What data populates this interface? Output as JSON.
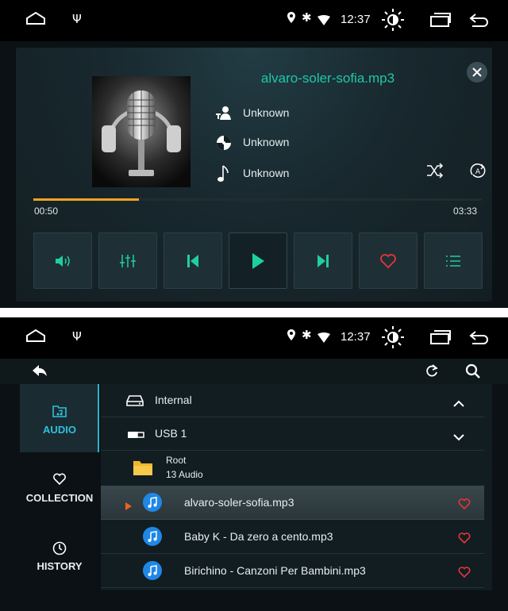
{
  "status_bar": {
    "time": "12:37",
    "icons": [
      "home-icon",
      "usb-icon",
      "location-icon",
      "bluetooth-icon",
      "wifi-icon",
      "brightness-icon",
      "recents-icon",
      "back-icon"
    ]
  },
  "player": {
    "title": "alvaro-soler-sofia.mp3",
    "artist": "Unknown",
    "album": "Unknown",
    "genre": "Unknown",
    "current_time": "00:50",
    "total_time": "03:33",
    "progress": 0.235,
    "accent_color": "#1fc7a8",
    "progress_color": "#f2a51f",
    "controls": [
      "volume",
      "equalizer",
      "previous",
      "play",
      "next",
      "favorite",
      "playlist"
    ]
  },
  "library": {
    "tabs": [
      {
        "label": "AUDIO",
        "icon": "music-folder-icon",
        "active": true
      },
      {
        "label": "COLLECTION",
        "icon": "heart-icon",
        "active": false
      },
      {
        "label": "HISTORY",
        "icon": "clock-icon",
        "active": false
      }
    ],
    "drives": [
      {
        "label": "Internal",
        "expanded": true
      },
      {
        "label": "USB 1",
        "expanded": false
      }
    ],
    "folder": {
      "name": "Root",
      "count": "13 Audio"
    },
    "tracks": [
      {
        "name": "alvaro-soler-sofia.mp3",
        "playing": true
      },
      {
        "name": "Baby K - Da zero a cento.mp3",
        "playing": false
      },
      {
        "name": "Birichino - Canzoni Per Bambini.mp3",
        "playing": false
      }
    ],
    "active_color": "#2ec0dc",
    "favorite_color": "#e5343a"
  }
}
